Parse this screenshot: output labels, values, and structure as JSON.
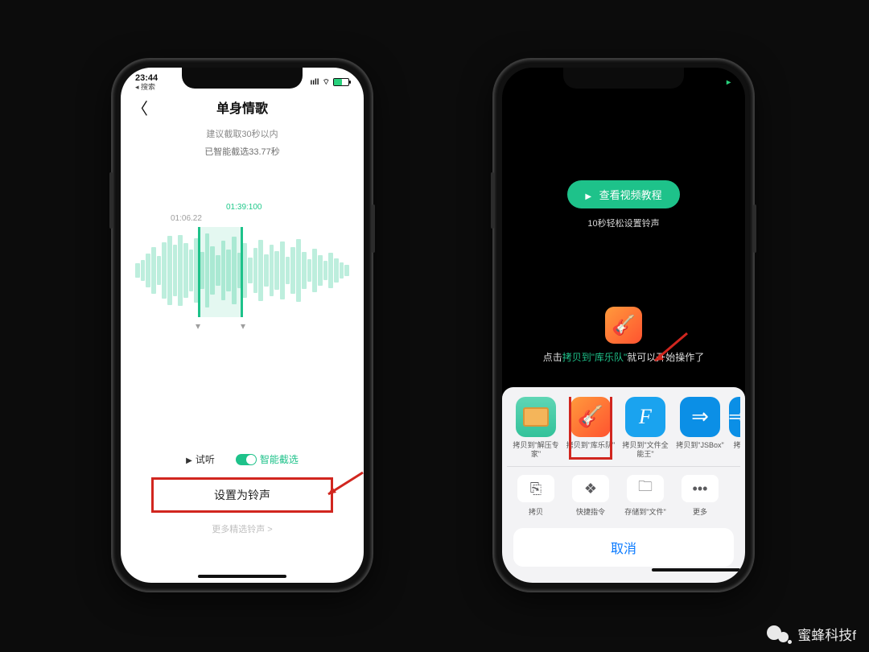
{
  "left": {
    "status": {
      "time": "23:44",
      "back": "◂ 搜索"
    },
    "title": "单身情歌",
    "hint1": "建议截取30秒以内",
    "hint2": "已智能截选33.77秒",
    "ts_end": "01:39:100",
    "ts_start": "01:06.22",
    "preview": "试听",
    "smart": "智能截选",
    "primary": "设置为铃声",
    "more": "更多精选铃声 >"
  },
  "right": {
    "tutorial": "查看视频教程",
    "tip": "10秒轻松设置铃声",
    "instr_pre": "点击",
    "instr_link": "拷贝到\"库乐队\"",
    "instr_post": "就可以开始操作了",
    "apps": {
      "unzip": "拷贝到\"解压专家\"",
      "gb": "拷贝到\"库乐队\"",
      "file": "拷贝到\"文件全能王\"",
      "jsbox": "拷贝到\"JSBox\"",
      "cut": "拷"
    },
    "actions": {
      "copy": "拷贝",
      "shortcut": "快捷指令",
      "save": "存储到\"文件\"",
      "more": "更多"
    },
    "cancel": "取消"
  },
  "watermark": "蜜蜂科技f"
}
